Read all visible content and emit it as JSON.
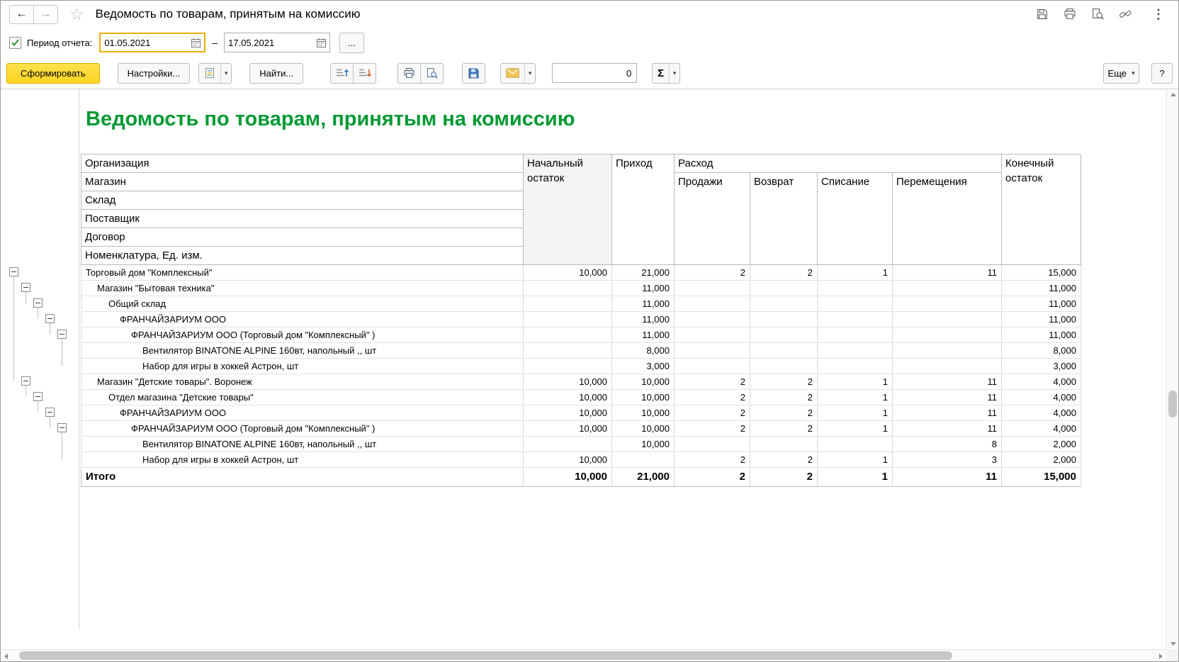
{
  "colors": {
    "title_green": "#009933",
    "generate_yellow": "#FFD521",
    "focus_border": "#F0B000"
  },
  "icons": {
    "back": "←",
    "forward": "→",
    "star": "☆",
    "kebab": "⋮",
    "caret": "▾",
    "sigma": "Σ"
  },
  "titlebar": {
    "title": "Ведомость по товарам, принятым на комиссию"
  },
  "period": {
    "label": "Период отчета:",
    "checked": true,
    "date_from": "01.05.2021",
    "date_to": "17.05.2021",
    "dash": "–",
    "ellipsis_button": "..."
  },
  "toolbar": {
    "generate_button": "Сформировать",
    "settings_button": "Настройки...",
    "find_button": "Найти...",
    "counter_value": "0",
    "more_button": "Еще",
    "help_button": "?"
  },
  "report": {
    "title": "Ведомость по товарам, принятым на комиссию",
    "header": {
      "group_fields": [
        "Организация",
        "Магазин",
        "Склад",
        "Поставщик",
        "Договор",
        "Номенклатура, Ед. изм."
      ],
      "initial_balance": "Начальный остаток",
      "income": "Приход",
      "expense": "Расход",
      "expense_columns": [
        "Продажи",
        "Возврат",
        "Списание",
        "Перемещения"
      ],
      "final_balance": "Конечный остаток"
    },
    "rows": [
      {
        "level": 0,
        "label": "Торговый дом \"Комплексный\"",
        "values": [
          "10,000",
          "21,000",
          "2",
          "2",
          "1",
          "11",
          "15,000"
        ]
      },
      {
        "level": 1,
        "label": "Магазин \"Бытовая техника\"",
        "values": [
          "",
          "11,000",
          "",
          "",
          "",
          "",
          "11,000"
        ]
      },
      {
        "level": 2,
        "label": "Общий склад",
        "values": [
          "",
          "11,000",
          "",
          "",
          "",
          "",
          "11,000"
        ]
      },
      {
        "level": 3,
        "label": "ФРАНЧАЙЗАРИУМ ООО",
        "values": [
          "",
          "11,000",
          "",
          "",
          "",
          "",
          "11,000"
        ]
      },
      {
        "level": 4,
        "label": "ФРАНЧАЙЗАРИУМ ООО (Торговый дом \"Комплексный\" )",
        "values": [
          "",
          "11,000",
          "",
          "",
          "",
          "",
          "11,000"
        ]
      },
      {
        "level": 5,
        "label": "Вентилятор BINATONE ALPINE 160вт, напольный ,, шт",
        "values": [
          "",
          "8,000",
          "",
          "",
          "",
          "",
          "8,000"
        ]
      },
      {
        "level": 5,
        "label": "Набор для игры в хоккей Астрон, шт",
        "values": [
          "",
          "3,000",
          "",
          "",
          "",
          "",
          "3,000"
        ]
      },
      {
        "level": 1,
        "label": "Магазин \"Детские товары\". Воронеж",
        "values": [
          "10,000",
          "10,000",
          "2",
          "2",
          "1",
          "11",
          "4,000"
        ]
      },
      {
        "level": 2,
        "label": "Отдел магазина \"Детские товары\"",
        "values": [
          "10,000",
          "10,000",
          "2",
          "2",
          "1",
          "11",
          "4,000"
        ]
      },
      {
        "level": 3,
        "label": "ФРАНЧАЙЗАРИУМ ООО",
        "values": [
          "10,000",
          "10,000",
          "2",
          "2",
          "1",
          "11",
          "4,000"
        ]
      },
      {
        "level": 4,
        "label": "ФРАНЧАЙЗАРИУМ ООО (Торговый дом \"Комплексный\" )",
        "values": [
          "10,000",
          "10,000",
          "2",
          "2",
          "1",
          "11",
          "4,000"
        ]
      },
      {
        "level": 5,
        "label": "Вентилятор BINATONE ALPINE 160вт, напольный ,, шт",
        "values": [
          "",
          "10,000",
          "",
          "",
          "",
          "8",
          "2,000"
        ]
      },
      {
        "level": 5,
        "label": "Набор для игры в хоккей Астрон, шт",
        "values": [
          "10,000",
          "",
          "2",
          "2",
          "1",
          "3",
          "2,000"
        ]
      }
    ],
    "total": {
      "label": "Итого",
      "values": [
        "10,000",
        "21,000",
        "2",
        "2",
        "1",
        "11",
        "15,000"
      ]
    }
  }
}
